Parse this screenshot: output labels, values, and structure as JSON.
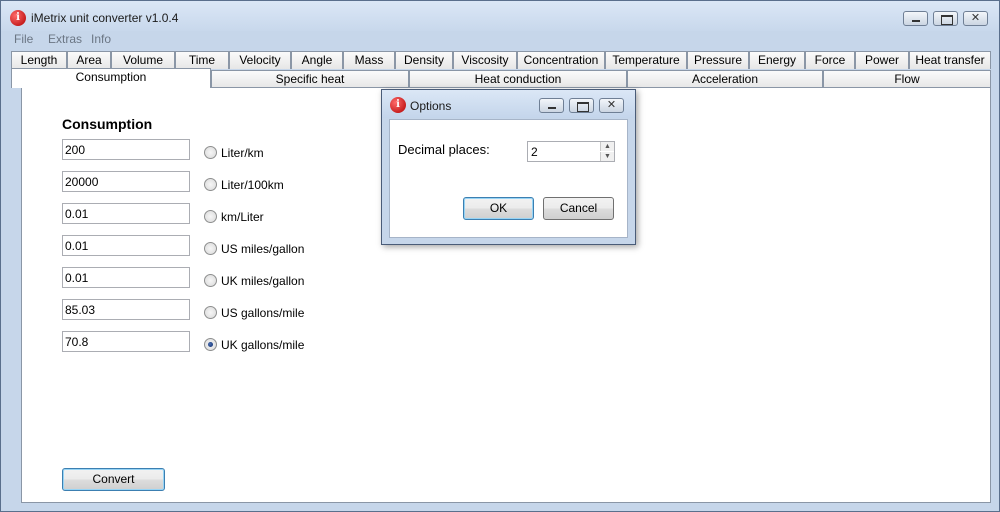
{
  "window": {
    "title": "iMetrix unit converter v1.0.4"
  },
  "menu": [
    "File",
    "Extras",
    "Info"
  ],
  "tabs_row1": [
    "Length",
    "Area",
    "Volume",
    "Time",
    "Velocity",
    "Angle",
    "Mass",
    "Density",
    "Viscosity",
    "Concentration",
    "Temperature",
    "Pressure",
    "Energy",
    "Force",
    "Power",
    "Heat transfer"
  ],
  "tabs_row2": [
    "Consumption",
    "Specific heat",
    "Heat conduction",
    "Acceleration",
    "Flow"
  ],
  "selected_tab": "Consumption",
  "panel": {
    "title": "Consumption",
    "rows": [
      {
        "value": "200",
        "unit": "Liter/km",
        "checked": false
      },
      {
        "value": "20000",
        "unit": "Liter/100km",
        "checked": false
      },
      {
        "value": "0.01",
        "unit": "km/Liter",
        "checked": false
      },
      {
        "value": "0.01",
        "unit": "US miles/gallon",
        "checked": false
      },
      {
        "value": "0.01",
        "unit": "UK miles/gallon",
        "checked": false
      },
      {
        "value": "85.03",
        "unit": "US gallons/mile",
        "checked": false
      },
      {
        "value": "70.8",
        "unit": "UK gallons/mile",
        "checked": true
      }
    ],
    "convert_label": "Convert"
  },
  "dialog": {
    "title": "Options",
    "label": "Decimal places:",
    "decimal_value": "2",
    "ok_label": "OK",
    "cancel_label": "Cancel"
  }
}
